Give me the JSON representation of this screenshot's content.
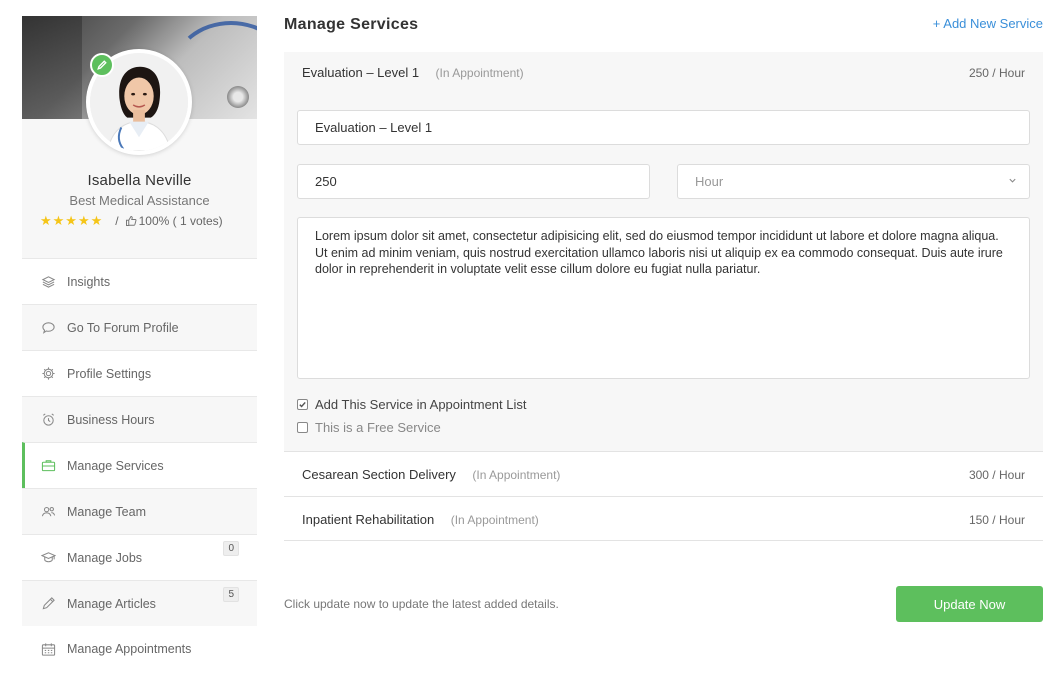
{
  "profile": {
    "name": "Isabella Neville",
    "subtitle": "Best Medical Assistance",
    "stars": "★★★★★",
    "rating_separator": "/",
    "rating_text": "100% ( 1 votes)"
  },
  "sidebar": {
    "items": [
      {
        "label": "Insights",
        "icon": "layers-icon"
      },
      {
        "label": "Go To Forum Profile",
        "icon": "chat-icon"
      },
      {
        "label": "Profile Settings",
        "icon": "gear-icon"
      },
      {
        "label": "Business Hours",
        "icon": "alarm-clock-icon"
      },
      {
        "label": "Manage Services",
        "icon": "briefcase-icon",
        "active": true
      },
      {
        "label": "Manage Team",
        "icon": "users-icon"
      },
      {
        "label": "Manage Jobs",
        "icon": "graduation-cap-icon",
        "count": "0"
      },
      {
        "label": "Manage Articles",
        "icon": "pencil-icon",
        "count": "5"
      },
      {
        "label": "Manage Appointments",
        "icon": "calendar-icon"
      }
    ]
  },
  "main": {
    "title": "Manage Services",
    "add_link": "+ Add New Service",
    "services": [
      {
        "name": "Evaluation – Level 1",
        "tag": "(In Appointment)",
        "rate": "250 / Hour",
        "expanded": true,
        "form": {
          "title_value": "Evaluation – Level 1",
          "price_value": "250",
          "unit_selected": "Hour",
          "description": "Lorem ipsum dolor sit amet, consectetur adipisicing elit, sed do eiusmod tempor incididunt ut labore et dolore magna aliqua. Ut enim ad minim veniam, quis nostrud exercitation ullamco laboris nisi ut aliquip ex ea commodo consequat. Duis aute irure dolor in reprehenderit in voluptate velit esse cillum dolore eu fugiat nulla pariatur.",
          "checkbox_appointment": "Add This Service in Appointment List",
          "checkbox_appointment_checked": true,
          "checkbox_free": "This is a Free Service",
          "checkbox_free_checked": false
        }
      },
      {
        "name": "Cesarean Section Delivery",
        "tag": "(In Appointment)",
        "rate": "300 / Hour"
      },
      {
        "name": "Inpatient Rehabilitation",
        "tag": "(In Appointment)",
        "rate": "150 / Hour"
      }
    ],
    "footer_note": "Click update now to update the latest added details.",
    "update_button": "Update Now"
  },
  "colors": {
    "accent_green": "#5dbf5d",
    "link_blue": "#3a8fd9",
    "star_yellow": "#f5c518"
  }
}
